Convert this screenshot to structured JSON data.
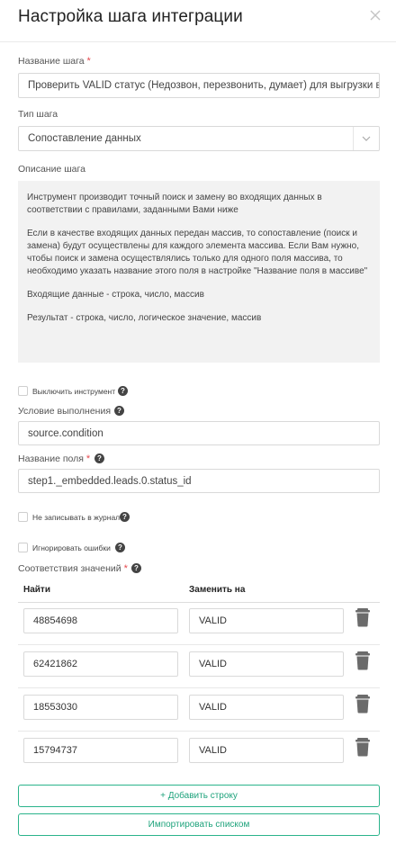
{
  "dialog": {
    "title": "Настройка шага интеграции"
  },
  "step_name": {
    "label": "Название шага",
    "required_mark": "*",
    "value": "Проверить VALID статус  (Недозвон, перезвонить, думает) для выгрузки в VK"
  },
  "step_type": {
    "label": "Тип шага",
    "value": "Сопоставление данных"
  },
  "description": {
    "label": "Описание шага",
    "paragraphs": [
      "Инструмент производит точный поиск и замену во входящих данных в соответствии с правилами, заданными Вами ниже",
      "Если в качестве входящих данных передан массив, то сопоставление (поиск и замена) будут осуществлены для каждого элемента массива. Если Вам нужно, чтобы поиск и замена осуществлялись только для одного поля массива, то необходимо указать название этого поля в настройке \"Название поля в массиве\"",
      "Входящие данные - строка, число, массив",
      "Результат - строка, число, логическое значение, массив"
    ]
  },
  "disable_tool": {
    "label": "Выключить инструмент",
    "checked": false
  },
  "condition": {
    "label": "Условие выполнения",
    "value": "source.condition"
  },
  "field_name": {
    "label": "Название поля",
    "required_mark": "*",
    "value": "step1._embedded.leads.0.status_id"
  },
  "no_log": {
    "label": "Не записывать в журнал",
    "checked": false
  },
  "ignore_errors": {
    "label": "Игнорировать ошибки",
    "checked": false
  },
  "mapping": {
    "label": "Соответствия значений",
    "required_mark": "*",
    "col_find": "Найти",
    "col_replace": "Заменить на",
    "rows": [
      {
        "find": "48854698",
        "replace": "VALID"
      },
      {
        "find": "62421862",
        "replace": "VALID"
      },
      {
        "find": "18553030",
        "replace": "VALID"
      },
      {
        "find": "15794737",
        "replace": "VALID"
      }
    ]
  },
  "buttons": {
    "add_row": "+ Добавить строку",
    "import_list": "Импортировать списком"
  },
  "colors": {
    "accent": "#1fa37c",
    "required": "#e5484d"
  }
}
